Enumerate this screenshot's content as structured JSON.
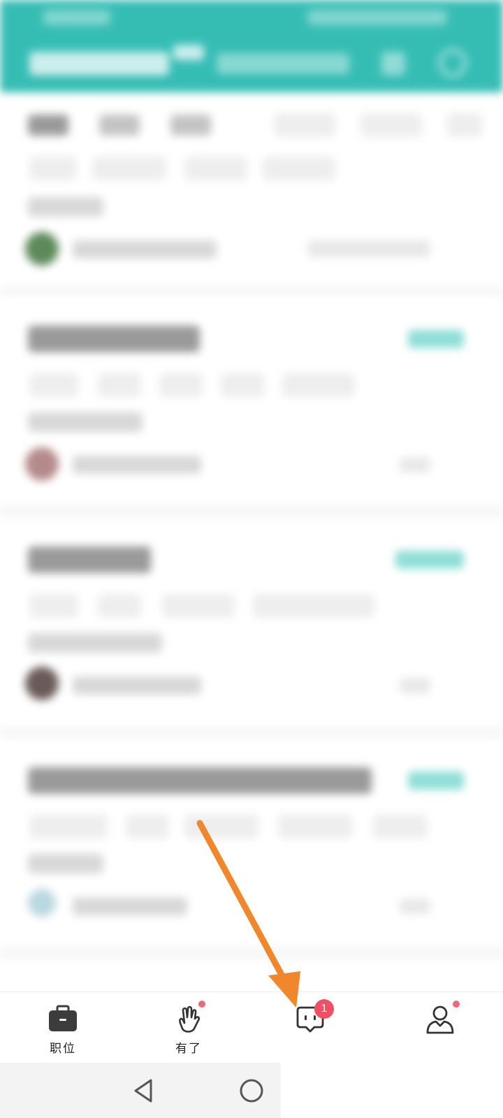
{
  "bottom_nav": {
    "items": [
      {
        "label": "职位",
        "icon": "briefcase-icon"
      },
      {
        "label": "有了",
        "icon": "hand-gesture-icon",
        "dot": true
      },
      {
        "label": "",
        "icon": "message-bubble-icon",
        "badge": "1"
      },
      {
        "label": "",
        "icon": "profile-icon",
        "dot": true
      }
    ]
  },
  "system_nav": {
    "buttons": [
      "back-triangle-icon",
      "home-circle-icon"
    ]
  },
  "colors": {
    "header": "#35bdb4",
    "accent": "#f0872c",
    "badge": "#f05064"
  }
}
